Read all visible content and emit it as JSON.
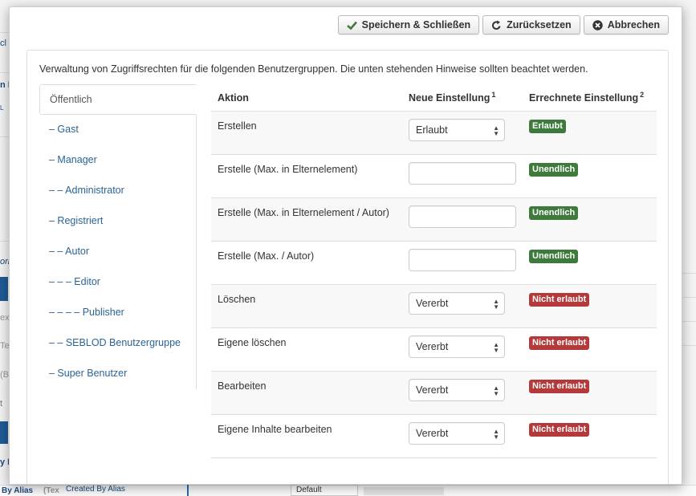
{
  "background": {
    "fragments": [
      "cl",
      "n F",
      "L",
      "orr",
      "ex",
      "Tex",
      "(B",
      "t",
      "y I"
    ],
    "bottom_row": {
      "alias_label": "By Alias",
      "type_label": "(Tex",
      "field_value": "Created By Alias",
      "select_value": "Default"
    }
  },
  "toolbar": {
    "save_close": "Speichern & Schließen",
    "reset": "Zurücksetzen",
    "cancel": "Abbrechen"
  },
  "info_text": "Verwaltung von Zugriffsrechten für die folgenden Benutzergruppen. Die unten stehenden Hinweise sollten beachtet werden.",
  "groups": [
    "Öffentlich",
    "– Gast",
    "– Manager",
    "– – Administrator",
    "– Registriert",
    "– – Autor",
    "– – – Editor",
    "– – – – Publisher",
    "– – SEBLOD Benutzergruppe",
    "– Super Benutzer"
  ],
  "table": {
    "headers": {
      "action": "Aktion",
      "new_setting": "Neue Einstellung",
      "new_setting_note": "1",
      "calculated": "Errechnete Einstellung",
      "calculated_note": "2"
    },
    "rows": [
      {
        "action": "Erstellen",
        "value": "Erlaubt",
        "badge": "Erlaubt"
      },
      {
        "action": "Erstelle (Max. in Elternelement)",
        "value": "",
        "badge": "Unendlich"
      },
      {
        "action": "Erstelle (Max. in Elternelement / Autor)",
        "value": "",
        "badge": "Unendlich"
      },
      {
        "action": "Erstelle (Max. / Autor)",
        "value": "",
        "badge": "Unendlich"
      },
      {
        "action": "Löschen",
        "value": "Vererbt",
        "badge": "Nicht erlaubt"
      },
      {
        "action": "Eigene löschen",
        "value": "Vererbt",
        "badge": "Nicht erlaubt"
      },
      {
        "action": "Bearbeiten",
        "value": "Vererbt",
        "badge": "Nicht erlaubt"
      },
      {
        "action": "Eigene Inhalte bearbeiten",
        "value": "Vererbt",
        "badge": "Nicht erlaubt"
      }
    ]
  },
  "colors": {
    "allowed": "#3d7a3c",
    "denied": "#b3393a",
    "link": "#2a6496"
  }
}
